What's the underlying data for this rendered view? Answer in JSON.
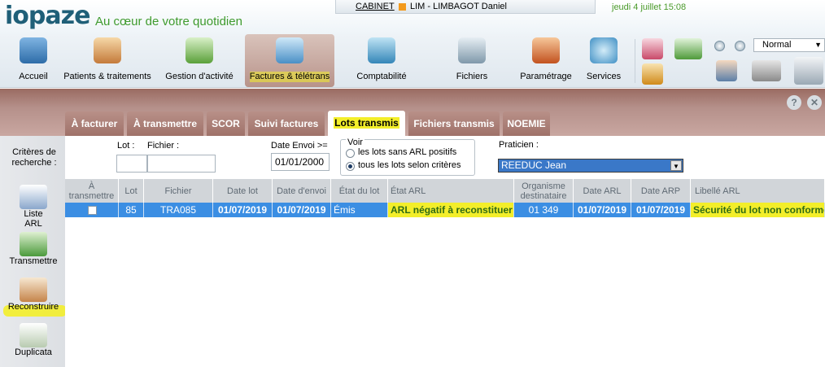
{
  "header": {
    "logo": "iopaze",
    "tagline": "Au cœur de votre quotidien",
    "cabinet_link": "CABINET",
    "user": "LIM - LIMBAGOT Daniel",
    "datetime": "jeudi 4 juillet 15:08"
  },
  "toolbar": {
    "items": [
      {
        "label": "Accueil",
        "icon": "house-icon"
      },
      {
        "label": "Patients & traitements",
        "icon": "patients-icon"
      },
      {
        "label": "Gestion d'activité",
        "icon": "activity-icon"
      },
      {
        "label": "Factures & télétrans",
        "icon": "invoice-icon"
      },
      {
        "label": "Comptabilité",
        "icon": "calculator-icon"
      },
      {
        "label": "Fichiers",
        "icon": "database-icon"
      },
      {
        "label": "Paramétrage",
        "icon": "settings-icon"
      },
      {
        "label": "Services",
        "icon": "globe-icon"
      }
    ],
    "zoom_value": "Normal"
  },
  "tabs": [
    {
      "label": "À facturer"
    },
    {
      "label": "À transmettre"
    },
    {
      "label": "SCOR"
    },
    {
      "label": "Suivi factures"
    },
    {
      "label": "Lots transmis"
    },
    {
      "label": "Fichiers transmis"
    },
    {
      "label": "NOEMIE"
    }
  ],
  "sidebar": {
    "criteria_label": "Critères de recherche :",
    "items": [
      {
        "label": "Liste ARL",
        "icon": "arl-list-icon"
      },
      {
        "label": "Transmettre",
        "icon": "transmit-icon"
      },
      {
        "label": "Reconstruire",
        "icon": "rebuild-icon"
      },
      {
        "label": "Duplicata",
        "icon": "duplicate-icon"
      }
    ]
  },
  "search": {
    "lot_label": "Lot :",
    "fichier_label": "Fichier :",
    "lot_value": "",
    "fichier_value": "",
    "date_label": "Date Envoi >=",
    "date_value": "01/01/2000",
    "voir_title": "Voir",
    "voir_options": [
      "les lots sans ARL positifs",
      "tous les lots selon critères"
    ],
    "voir_selected": 1,
    "praticien_label": "Praticien :",
    "praticien_value": "REEDUC Jean"
  },
  "table": {
    "columns": [
      "À transmettre",
      "Lot",
      "Fichier",
      "Date lot",
      "Date d'envoi",
      "État du lot",
      "État ARL",
      "Organisme destinataire",
      "Date ARL",
      "Date ARP",
      "Libellé ARL"
    ],
    "rows": [
      {
        "a_transmettre": false,
        "lot": "85",
        "fichier": "TRA085",
        "date_lot": "01/07/2019",
        "date_envoi": "01/07/2019",
        "etat_lot": "Émis",
        "etat_arl": "ARL négatif à reconstituer",
        "organisme": "01 349",
        "date_arl": "01/07/2019",
        "date_arp": "01/07/2019",
        "libelle_arl": "Sécurité du lot non conforme"
      }
    ]
  },
  "colors": {
    "highlight": "#f3ee2a",
    "selected_row": "#3b8ee3",
    "tab_bar": "#b5908a",
    "accent_green": "#3f9b2e"
  }
}
